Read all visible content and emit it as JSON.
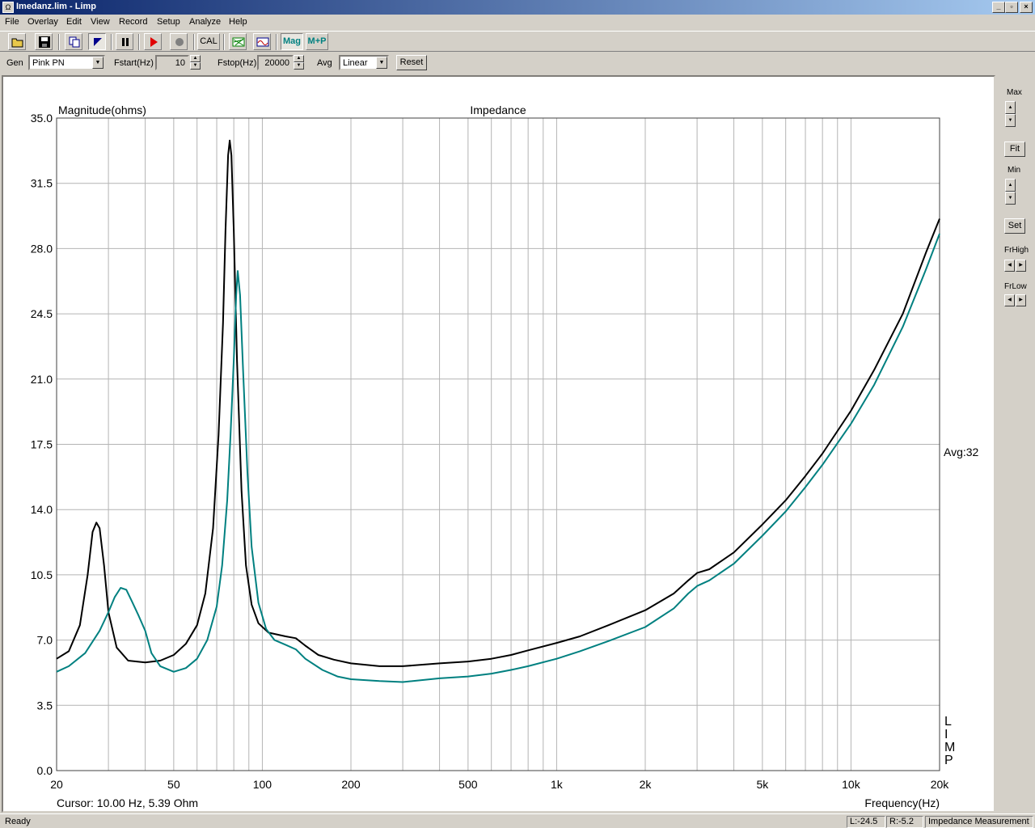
{
  "window": {
    "title": "Imedanz.lim - Limp",
    "minimize": "_",
    "restore": "▫",
    "close": "×"
  },
  "menu": [
    "File",
    "Overlay",
    "Edit",
    "View",
    "Record",
    "Setup",
    "Analyze",
    "Help"
  ],
  "toolbar": {
    "cal_label": "CAL",
    "mag_label": "Mag",
    "mp_label": "M+P"
  },
  "controls": {
    "gen_label": "Gen",
    "gen_value": "Pink PN",
    "fstart_label": "Fstart(Hz)",
    "fstart_value": "10",
    "fstop_label": "Fstop(Hz)",
    "fstop_value": "20000",
    "avg_label": "Avg",
    "avg_value": "Linear",
    "reset_label": "Reset"
  },
  "side": {
    "max_label": "Max",
    "fit_label": "Fit",
    "min_label": "Min",
    "set_label": "Set",
    "frhigh_label": "FrHigh",
    "frlow_label": "FrLow"
  },
  "chart_data": {
    "type": "line",
    "title": "Impedance",
    "ylabel": "Magnitude(ohms)",
    "xlabel": "Frequency(Hz)",
    "xscale": "log",
    "xlim": [
      20,
      20000
    ],
    "ylim": [
      0,
      35
    ],
    "xticks": [
      20,
      50,
      100,
      200,
      500,
      1000,
      2000,
      5000,
      10000,
      20000
    ],
    "xtick_labels": [
      "20",
      "50",
      "100",
      "200",
      "500",
      "1k",
      "2k",
      "5k",
      "10k",
      "20k"
    ],
    "yticks": [
      0,
      3.5,
      7,
      10.5,
      14,
      17.5,
      21,
      24.5,
      28,
      31.5,
      35
    ],
    "ytick_labels": [
      "0.0",
      "3.5",
      "7.0",
      "10.5",
      "14.0",
      "17.5",
      "21.0",
      "24.5",
      "28.0",
      "31.5",
      "35.0"
    ],
    "grid": true,
    "avg_annotation": "Avg:32",
    "watermark": "LIMP",
    "cursor_text": "Cursor: 10.00 Hz, 5.39 Ohm",
    "series": [
      {
        "color": "#000000",
        "points": [
          [
            20,
            6.0
          ],
          [
            22,
            6.4
          ],
          [
            24,
            7.8
          ],
          [
            25.5,
            10.5
          ],
          [
            26.5,
            12.8
          ],
          [
            27.3,
            13.3
          ],
          [
            28,
            13.0
          ],
          [
            29,
            11.0
          ],
          [
            30,
            8.5
          ],
          [
            32,
            6.6
          ],
          [
            35,
            5.9
          ],
          [
            40,
            5.8
          ],
          [
            45,
            5.9
          ],
          [
            50,
            6.2
          ],
          [
            55,
            6.8
          ],
          [
            60,
            7.8
          ],
          [
            64,
            9.5
          ],
          [
            68,
            13.0
          ],
          [
            71,
            18.0
          ],
          [
            73.5,
            24.0
          ],
          [
            75,
            29.0
          ],
          [
            76.5,
            33.0
          ],
          [
            77.5,
            33.8
          ],
          [
            78.5,
            33.0
          ],
          [
            80,
            29.0
          ],
          [
            82,
            22.0
          ],
          [
            85,
            15.0
          ],
          [
            88,
            11.0
          ],
          [
            92,
            8.9
          ],
          [
            97,
            7.9
          ],
          [
            105,
            7.4
          ],
          [
            120,
            7.2
          ],
          [
            130,
            7.1
          ],
          [
            140,
            6.7
          ],
          [
            155,
            6.2
          ],
          [
            175,
            5.95
          ],
          [
            200,
            5.75
          ],
          [
            250,
            5.6
          ],
          [
            300,
            5.6
          ],
          [
            400,
            5.75
          ],
          [
            500,
            5.85
          ],
          [
            600,
            6.0
          ],
          [
            700,
            6.2
          ],
          [
            800,
            6.45
          ],
          [
            1000,
            6.85
          ],
          [
            1200,
            7.2
          ],
          [
            1500,
            7.8
          ],
          [
            2000,
            8.6
          ],
          [
            2500,
            9.5
          ],
          [
            2800,
            10.2
          ],
          [
            3000,
            10.6
          ],
          [
            3300,
            10.8
          ],
          [
            4000,
            11.7
          ],
          [
            5000,
            13.2
          ],
          [
            6000,
            14.5
          ],
          [
            7000,
            15.8
          ],
          [
            8000,
            17.0
          ],
          [
            10000,
            19.3
          ],
          [
            12000,
            21.5
          ],
          [
            15000,
            24.5
          ],
          [
            18000,
            27.8
          ],
          [
            20000,
            29.6
          ]
        ]
      },
      {
        "color": "#008080",
        "points": [
          [
            20,
            5.3
          ],
          [
            22,
            5.6
          ],
          [
            25,
            6.3
          ],
          [
            28,
            7.5
          ],
          [
            30,
            8.5
          ],
          [
            31.5,
            9.3
          ],
          [
            33,
            9.8
          ],
          [
            34.5,
            9.7
          ],
          [
            36,
            9.1
          ],
          [
            38,
            8.3
          ],
          [
            40,
            7.5
          ],
          [
            42,
            6.3
          ],
          [
            45,
            5.6
          ],
          [
            50,
            5.3
          ],
          [
            55,
            5.5
          ],
          [
            60,
            6.0
          ],
          [
            65,
            7.0
          ],
          [
            70,
            8.8
          ],
          [
            73,
            11.0
          ],
          [
            76,
            14.5
          ],
          [
            78,
            18.0
          ],
          [
            80,
            22.0
          ],
          [
            81.5,
            25.5
          ],
          [
            82.5,
            26.8
          ],
          [
            84,
            25.5
          ],
          [
            86,
            21.5
          ],
          [
            89,
            16.0
          ],
          [
            92,
            12.0
          ],
          [
            97,
            9.0
          ],
          [
            103,
            7.6
          ],
          [
            110,
            7.0
          ],
          [
            120,
            6.75
          ],
          [
            130,
            6.5
          ],
          [
            140,
            6.0
          ],
          [
            160,
            5.4
          ],
          [
            180,
            5.05
          ],
          [
            200,
            4.9
          ],
          [
            250,
            4.8
          ],
          [
            300,
            4.75
          ],
          [
            400,
            4.95
          ],
          [
            500,
            5.05
          ],
          [
            600,
            5.2
          ],
          [
            700,
            5.4
          ],
          [
            800,
            5.6
          ],
          [
            1000,
            6.0
          ],
          [
            1200,
            6.4
          ],
          [
            1500,
            6.95
          ],
          [
            2000,
            7.7
          ],
          [
            2500,
            8.7
          ],
          [
            2800,
            9.5
          ],
          [
            3000,
            9.9
          ],
          [
            3300,
            10.2
          ],
          [
            4000,
            11.1
          ],
          [
            5000,
            12.6
          ],
          [
            6000,
            13.9
          ],
          [
            7000,
            15.2
          ],
          [
            8000,
            16.4
          ],
          [
            10000,
            18.6
          ],
          [
            12000,
            20.7
          ],
          [
            15000,
            23.8
          ],
          [
            18000,
            26.9
          ],
          [
            20000,
            28.8
          ]
        ]
      }
    ]
  },
  "status": {
    "ready": "Ready",
    "left": "L:-24.5",
    "right": "R:-5.2",
    "mode": "Impedance Measurement"
  }
}
